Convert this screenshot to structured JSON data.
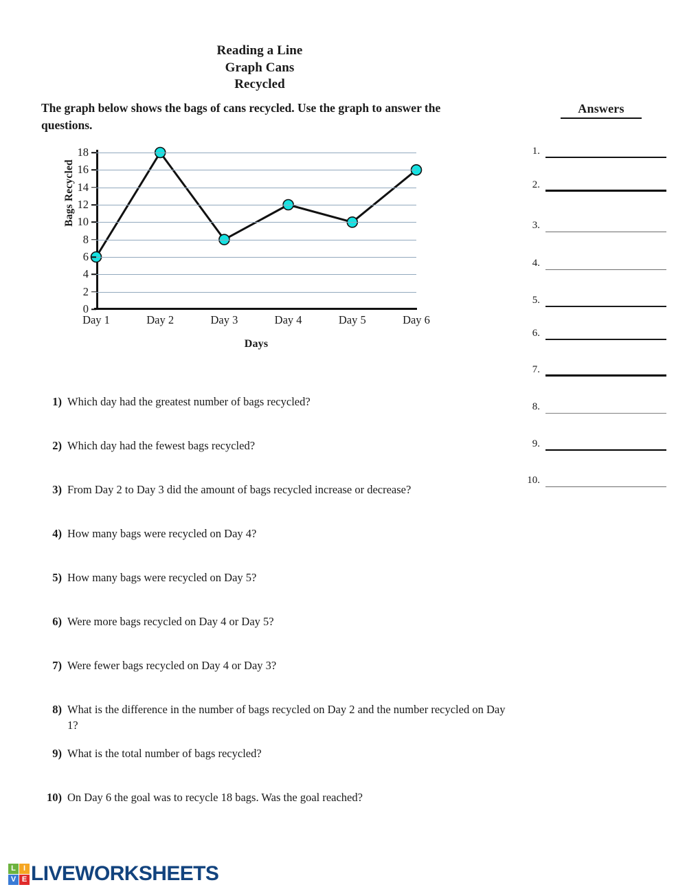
{
  "title": {
    "line1": "Reading a Line",
    "line2": "Graph Cans",
    "line3": "Recycled"
  },
  "instructions": "The graph below shows the bags of cans recycled. Use the graph to answer the questions.",
  "chart_data": {
    "type": "line",
    "title": "",
    "xlabel": "Days",
    "ylabel": "Bags Recycled",
    "categories": [
      "Day 1",
      "Day 2",
      "Day 3",
      "Day 4",
      "Day 5",
      "Day 6"
    ],
    "values": [
      6,
      18,
      8,
      12,
      10,
      16
    ],
    "yticks": [
      0,
      2,
      4,
      6,
      8,
      10,
      12,
      14,
      16,
      18
    ],
    "ylim": [
      0,
      18
    ],
    "grid": true,
    "legend": false,
    "marker_color": "#16e2e2",
    "line_color": "#111111",
    "gridline_color": "#91a8bd"
  },
  "questions": [
    {
      "num": "1)",
      "text": "Which day had the greatest number of bags recycled?"
    },
    {
      "num": "2)",
      "text": "Which day had the fewest bags recycled?"
    },
    {
      "num": "3)",
      "text": "From Day 2 to Day 3 did the amount of bags recycled increase or decrease?"
    },
    {
      "num": "4)",
      "text": "How many bags were recycled on Day 4?"
    },
    {
      "num": "5)",
      "text": "How many bags were recycled on Day 5?"
    },
    {
      "num": "6)",
      "text": "Were more bags recycled on Day 4 or Day 5?"
    },
    {
      "num": "7)",
      "text": "Were fewer bags recycled on Day 4 or Day 3?"
    },
    {
      "num": "8)",
      "text": "What is the difference in the number of bags recycled on Day 2 and the number recycled on Day 1?"
    },
    {
      "num": "9)",
      "text": "What is the total number of bags recycled?"
    },
    {
      "num": "10)",
      "text": "On Day 6 the goal was to recycle 18 bags. Was the goal reached?"
    }
  ],
  "answers": {
    "heading": "Answers",
    "rows": [
      {
        "num": "1."
      },
      {
        "num": "2."
      },
      {
        "num": "3."
      },
      {
        "num": "4."
      },
      {
        "num": "5."
      },
      {
        "num": "6."
      },
      {
        "num": "7."
      },
      {
        "num": "8."
      },
      {
        "num": "9."
      },
      {
        "num": "10."
      }
    ]
  },
  "footer": {
    "brand": "LIVEWORKSHEETS",
    "brand_color": "#12437e",
    "tiles": [
      {
        "letter": "L",
        "color": "#6cb33f"
      },
      {
        "letter": "I",
        "color": "#f5a623"
      },
      {
        "letter": "V",
        "color": "#3a7bd5"
      },
      {
        "letter": "E",
        "color": "#e02b2b"
      }
    ]
  }
}
